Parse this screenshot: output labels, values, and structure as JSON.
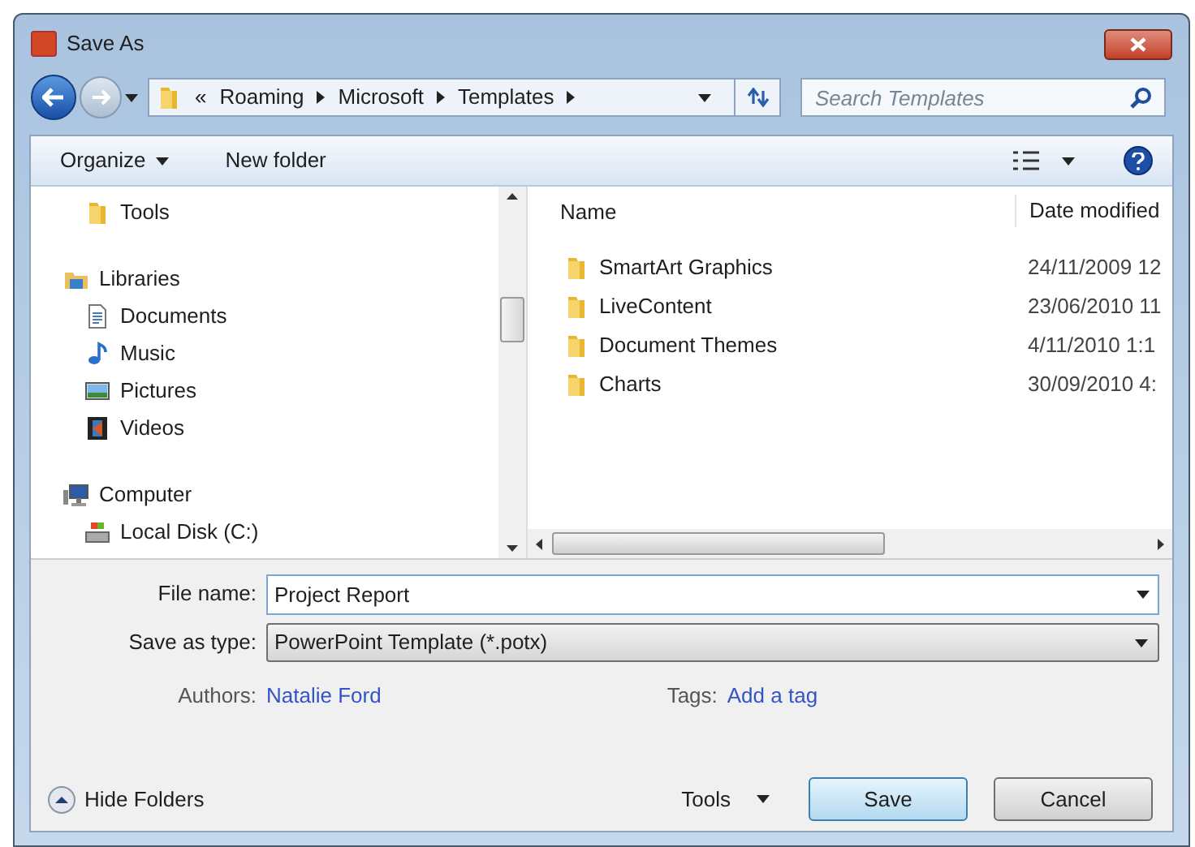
{
  "window": {
    "title": "Save As"
  },
  "address": {
    "crumbs": [
      "Roaming",
      "Microsoft",
      "Templates"
    ],
    "overflow": "«"
  },
  "search": {
    "placeholder": "Search Templates"
  },
  "toolbar": {
    "organize": "Organize",
    "new_folder": "New folder"
  },
  "sidebar": {
    "items": [
      {
        "label": "Tools",
        "kind": "folder"
      },
      {
        "label": "Libraries",
        "kind": "library",
        "children": [
          {
            "label": "Documents",
            "kind": "document"
          },
          {
            "label": "Music",
            "kind": "music"
          },
          {
            "label": "Pictures",
            "kind": "pictures"
          },
          {
            "label": "Videos",
            "kind": "videos"
          }
        ]
      },
      {
        "label": "Computer",
        "kind": "computer",
        "children": [
          {
            "label": "Local Disk (C:)",
            "kind": "disk"
          }
        ]
      }
    ]
  },
  "table": {
    "columns": [
      "Name",
      "Date modified"
    ],
    "rows": [
      {
        "name": "SmartArt Graphics",
        "date": "24/11/2009 12"
      },
      {
        "name": "LiveContent",
        "date": "23/06/2010 11"
      },
      {
        "name": "Document Themes",
        "date": "4/11/2010 1:1"
      },
      {
        "name": "Charts",
        "date": "30/09/2010 4:"
      }
    ]
  },
  "form": {
    "file_name_label": "File name:",
    "file_name": "Project Report",
    "type_label": "Save as type:",
    "type": "PowerPoint Template (*.potx)",
    "authors_label": "Authors:",
    "authors": "Natalie Ford",
    "tags_label": "Tags:",
    "tags": "Add a tag"
  },
  "footer": {
    "hide_folders": "Hide Folders",
    "tools": "Tools",
    "save": "Save",
    "cancel": "Cancel"
  }
}
